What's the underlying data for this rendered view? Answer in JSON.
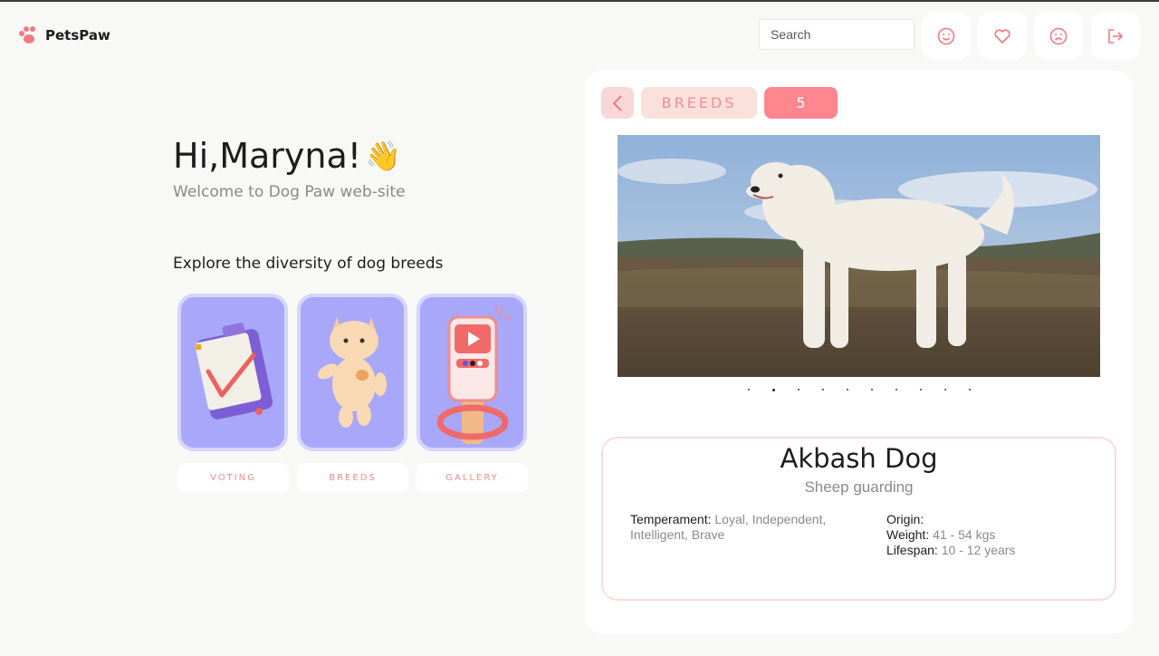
{
  "header": {
    "logo_text": "PetsPaw",
    "search_placeholder": "Search",
    "buttons": [
      {
        "name": "likes",
        "icon": "smile-icon"
      },
      {
        "name": "favourites",
        "icon": "heart-icon"
      },
      {
        "name": "dislikes",
        "icon": "sad-face-icon"
      },
      {
        "name": "logout",
        "icon": "logout-icon"
      }
    ]
  },
  "welcome": {
    "greeting": "Hi,Maryna!",
    "emoji": "👋",
    "subtitle": "Welcome to Dog Paw web-site",
    "explore_title": "Explore the diversity of dog breeds",
    "cards": [
      {
        "label": "VOTING",
        "icon": "clipboard-icon"
      },
      {
        "label": "BREEDS",
        "icon": "cat-icon"
      },
      {
        "label": "GALLERY",
        "icon": "phone-gallery-icon"
      }
    ]
  },
  "breed_page": {
    "section_label": "BREEDS",
    "breed_id": "5",
    "slider_dots": 10,
    "active_dot": 2,
    "breed_name": "Akbash Dog",
    "bred_for": "Sheep guarding",
    "temperament_label": "Temperament:",
    "temperament_value": "Loyal, Independent, Intelligent, Brave",
    "origin_label": "Origin:",
    "origin_value": "",
    "weight_label": "Weight:",
    "weight_value": "41 - 54 kgs",
    "lifespan_label": "Lifespan:",
    "lifespan_value": "10 - 12 years"
  },
  "colors": {
    "accent": "#ff868e",
    "accent_light": "#fbe0dc",
    "card_bg": "#a9a7fa"
  }
}
